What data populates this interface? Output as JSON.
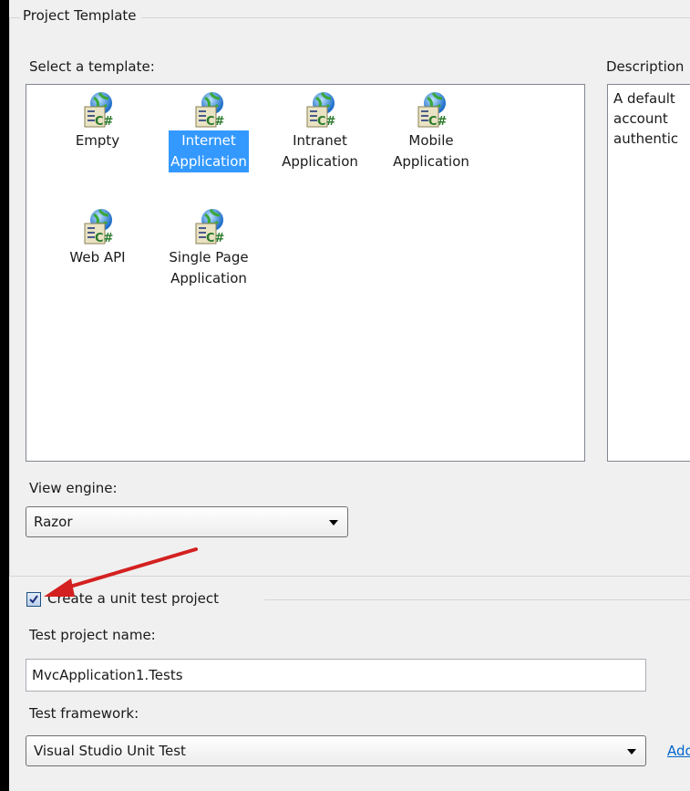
{
  "project_template": {
    "group_title": "Project Template",
    "select_label": "Select a template:",
    "description_label": "Description",
    "description_text": "A default\naccount\nauthentic",
    "templates": [
      {
        "line1": "Empty",
        "line2": "",
        "icon": "csharp-web-template-icon",
        "selected": false
      },
      {
        "line1": "Internet",
        "line2": "Application",
        "icon": "csharp-web-template-icon",
        "selected": true
      },
      {
        "line1": "Intranet",
        "line2": "Application",
        "icon": "csharp-web-template-icon",
        "selected": false
      },
      {
        "line1": "Mobile",
        "line2": "Application",
        "icon": "csharp-web-template-icon",
        "selected": false
      },
      {
        "line1": "Web API",
        "line2": "",
        "icon": "csharp-web-template-icon",
        "selected": false
      },
      {
        "line1": "Single Page",
        "line2": "Application",
        "icon": "csharp-web-template-icon",
        "selected": false
      }
    ],
    "view_engine_label": "View engine:",
    "view_engine_value": "Razor"
  },
  "unit_test": {
    "checkbox_label": "Create a unit test project",
    "checked": true,
    "test_project_name_label": "Test project name:",
    "test_project_name_value": "MvcApplication1.Tests",
    "test_framework_label": "Test framework:",
    "test_framework_value": "Visual Studio Unit Test",
    "add_link": "Ado"
  },
  "annotation": {
    "arrow_color": "#d42020"
  },
  "colors": {
    "selection": "#3399ff",
    "link": "#0066cc"
  }
}
